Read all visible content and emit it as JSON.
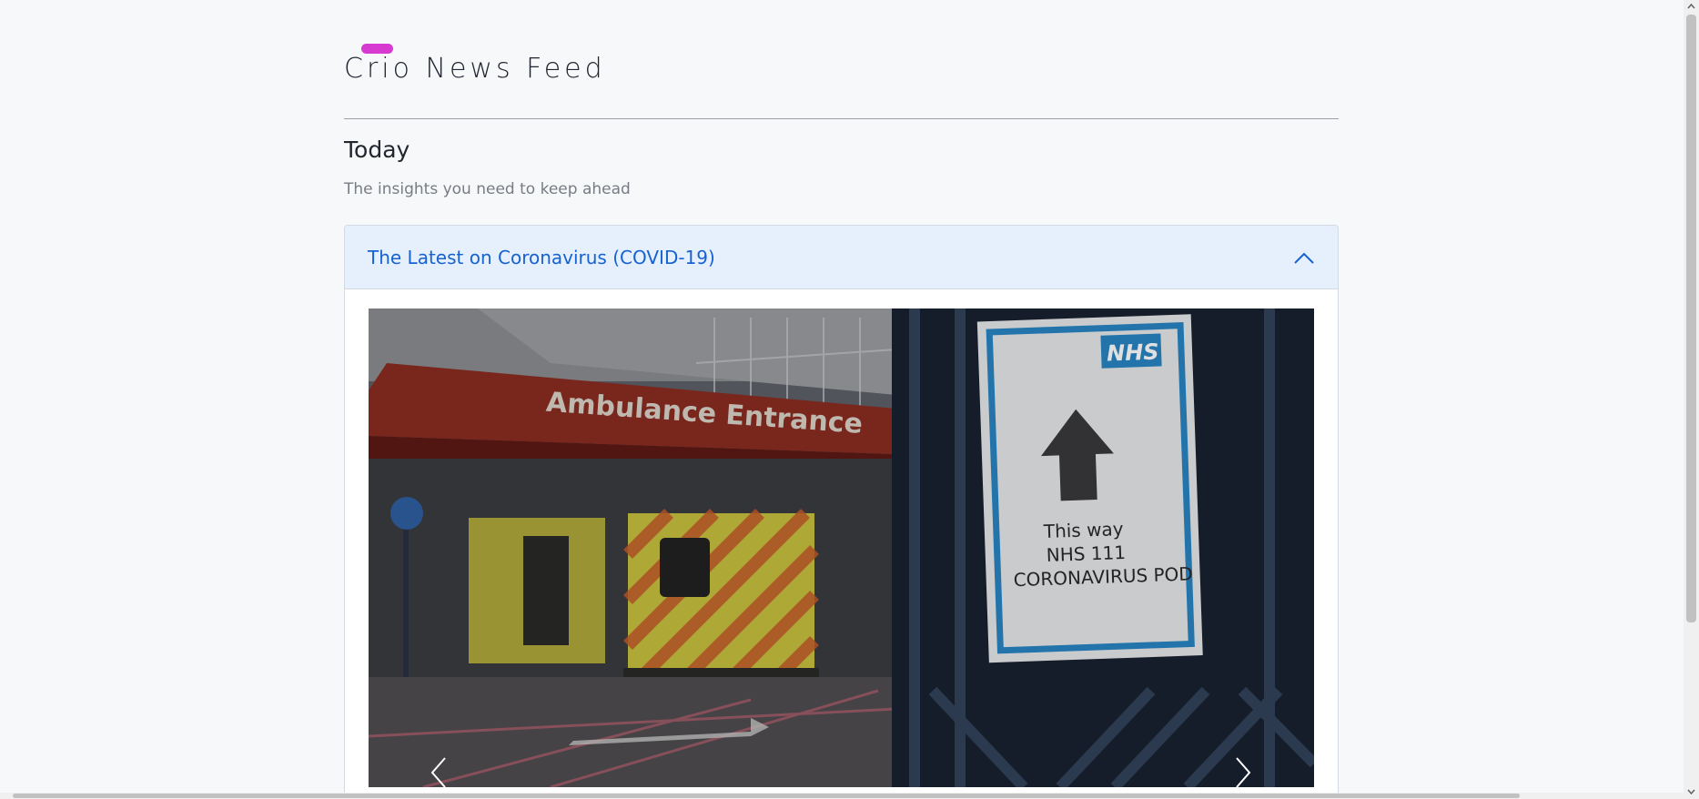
{
  "header": {
    "brand_title": "Crio News Feed"
  },
  "intro": {
    "heading": "Today",
    "subheading": "The insights you need to keep ahead"
  },
  "accordion": {
    "title": "The Latest on Coronavirus (COVID-19)",
    "state_icon": "chevron-up-icon"
  },
  "carousel": {
    "image_texts": {
      "canopy_sign": "Ambulance Entrance",
      "nhs_logo": "NHS",
      "poster_line_1": "This way",
      "poster_line_2": "NHS 111",
      "poster_line_3": "CORONAVIRUS POD"
    },
    "prev_icon": "chevron-left-icon",
    "next_icon": "chevron-right-icon"
  },
  "colors": {
    "brand_accent": "#d63ad0",
    "link_blue": "#1762d1",
    "accordion_header_bg": "#e6f0fd",
    "page_bg": "#f7f8fa"
  }
}
